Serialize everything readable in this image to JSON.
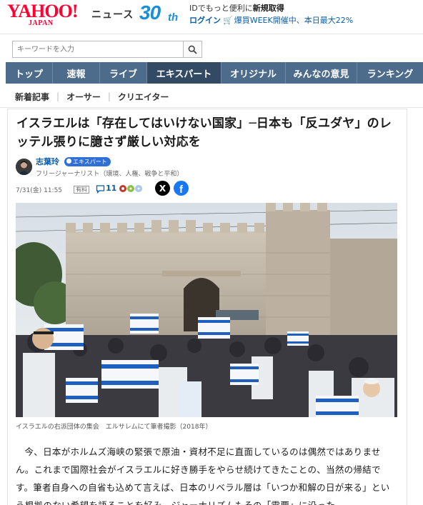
{
  "header": {
    "logo_text": "YAHOO!",
    "logo_sub": "JAPAN",
    "service_name": "ニュース",
    "anniversary_num": "30",
    "anniversary_suffix": "th",
    "promo_line1_prefix": "IDでもっと便利に",
    "promo_line1_link": "新規取得",
    "login_label": "ログイン",
    "promo_line2": "爆買WEEK開催中、本日最大22%"
  },
  "search": {
    "placeholder": "キーワードを入力"
  },
  "nav": {
    "items": [
      {
        "label": "トップ"
      },
      {
        "label": "速報"
      },
      {
        "label": "ライブ"
      },
      {
        "label": "エキスパート"
      },
      {
        "label": "オリジナル"
      },
      {
        "label": "みんなの意見"
      },
      {
        "label": "ランキング"
      }
    ],
    "active_index": 3
  },
  "subnav": {
    "items": [
      {
        "label": "新着記事"
      },
      {
        "label": "オーサー"
      },
      {
        "label": "クリエイター"
      }
    ]
  },
  "article": {
    "title": "イスラエルは「存在してはいけない国家」─日本も「反ユダヤ」のレッテル張りに臆さず厳しい対応を",
    "author_name": "志葉玲",
    "author_badge": "エキスパート",
    "author_desc": "フリージャーナリスト（環境、人権、戦争と平和）",
    "date": "7/31(金) 11:55",
    "tag": "有料",
    "comment_count": "11",
    "share_x": "X",
    "share_fb": "f",
    "caption": "イスラエルの右派団体の集会　エルサレムにて筆者撮影（2018年）",
    "body": "今、日本がホルムズ海峡の緊張で原油・資材不足に直面しているのは偶然ではありません。これまで国際社会がイスラエルに好き勝手をやらせ続けてきたことの、当然の帰結です。筆者自身への自省も込めて言えば、日本のリベラル層は「いつか和解の日が来る」という根拠のない希望を語ることを好み、ジャーナリズムもその「需要」に沿った"
  },
  "colors": {
    "brand_red": "#ff0033",
    "nav_bg": "#4d6b8a",
    "nav_active": "#324a63",
    "link_blue": "#0a5ea8"
  }
}
